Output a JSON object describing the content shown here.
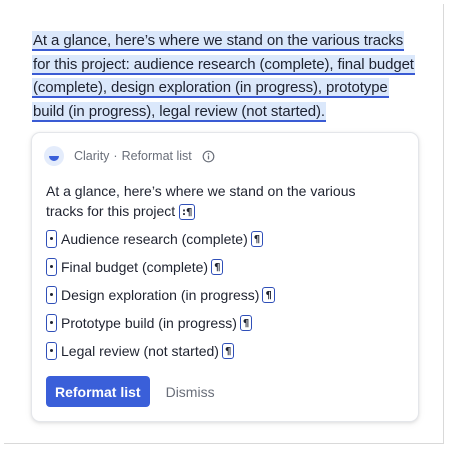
{
  "selection": {
    "text": "At a glance, here’s where we stand on the various tracks for this project: audience research (complete), final budget (complete), design exploration (in progress), prototype build (in progress), legal review (not started)."
  },
  "card": {
    "app_name": "Clarity",
    "separator": "·",
    "action_title": "Reformat list",
    "logo_icon": "clarity-logo-icon",
    "info_icon": "info-icon",
    "intro_text": "At a glance, here’s where we stand on the various tracks for this project ",
    "intro_mark": ":¶",
    "pilcrow": "¶",
    "items": [
      {
        "label": "Audience research (complete)"
      },
      {
        "label": "Final budget (complete)"
      },
      {
        "label": "Design exploration (in progress)"
      },
      {
        "label": "Prototype build (in progress)"
      },
      {
        "label": "Legal review (not started)"
      }
    ],
    "primary_button": "Reformat list",
    "secondary_button": "Dismiss"
  },
  "colors": {
    "accent": "#3a5fd9",
    "highlight": "#dbe8fb",
    "underline": "#3a5bd4",
    "mark_border": "#2f4fb8"
  }
}
